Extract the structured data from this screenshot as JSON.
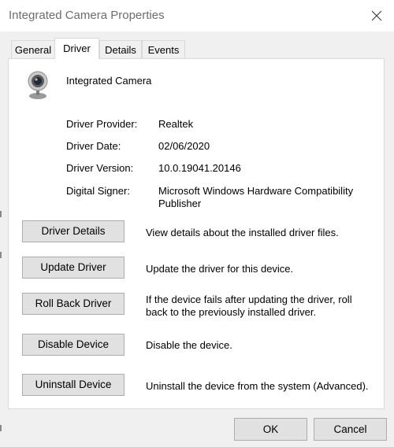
{
  "window": {
    "title": "Integrated Camera Properties"
  },
  "tabs": [
    {
      "label": "General"
    },
    {
      "label": "Driver"
    },
    {
      "label": "Details"
    },
    {
      "label": "Events"
    }
  ],
  "device": {
    "name": "Integrated Camera",
    "icon": "webcam-icon"
  },
  "info": {
    "provider_label": "Driver Provider:",
    "provider_value": "Realtek",
    "date_label": "Driver Date:",
    "date_value": "02/06/2020",
    "version_label": "Driver Version:",
    "version_value": "10.0.19041.20146",
    "signer_label": "Digital Signer:",
    "signer_value": "Microsoft Windows Hardware Compatibility Publisher"
  },
  "actions": [
    {
      "label": "Driver Details",
      "description": "View details about the installed driver files."
    },
    {
      "label": "Update Driver",
      "description": "Update the driver for this device."
    },
    {
      "label": "Roll Back Driver",
      "description": "If the device fails after updating the driver, roll back to the previously installed driver."
    },
    {
      "label": "Disable Device",
      "description": "Disable the device."
    },
    {
      "label": "Uninstall Device",
      "description": "Uninstall the device from the system (Advanced)."
    }
  ],
  "footer": {
    "ok_label": "OK",
    "cancel_label": "Cancel"
  }
}
